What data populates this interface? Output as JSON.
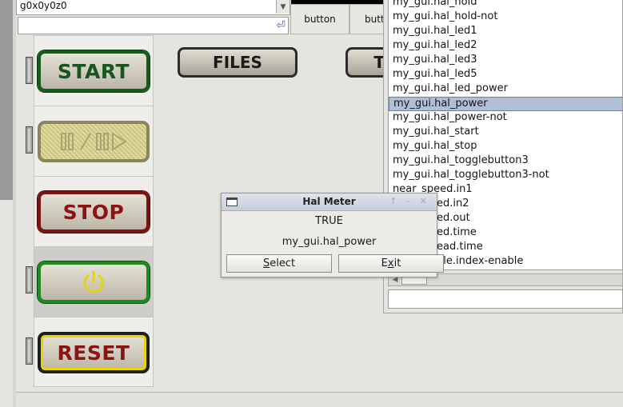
{
  "combo": {
    "value": "g0x0y0z0",
    "arrow_icon": "chevron-down-icon"
  },
  "entry": {
    "value": "",
    "enter_icon": "return-arrow-icon"
  },
  "top_buttons": [
    "button",
    "butt"
  ],
  "control_buttons": {
    "start": "START",
    "pause_icon": "pause-step-icon",
    "stop": "STOP",
    "power_icon": "power-icon",
    "reset": "RESET"
  },
  "files_button": "FILES",
  "partial_button": "T",
  "pin_list": {
    "items": [
      "my_gui.hal_hold",
      "my_gui.hal_hold-not",
      "my_gui.hal_led1",
      "my_gui.hal_led2",
      "my_gui.hal_led3",
      "my_gui.hal_led5",
      "my_gui.hal_led_power",
      "my_gui.hal_power",
      "my_gui.hal_power-not",
      "my_gui.hal_start",
      "my_gui.hal_stop",
      "my_gui.hal_togglebutton3",
      "my_gui.hal_togglebutton3-not",
      "near_speed.in1",
      "ed.in2",
      "ed.out",
      "ed.time",
      "ead.time",
      "dle.index-enable"
    ],
    "selected_index": 7
  },
  "hal_meter": {
    "title": "Hal Meter",
    "value": "TRUE",
    "pin": "my_gui.hal_power",
    "select_first": "S",
    "select_rest": "elect",
    "exit_first": "E",
    "exit_x": "x",
    "exit_rest": "it"
  }
}
